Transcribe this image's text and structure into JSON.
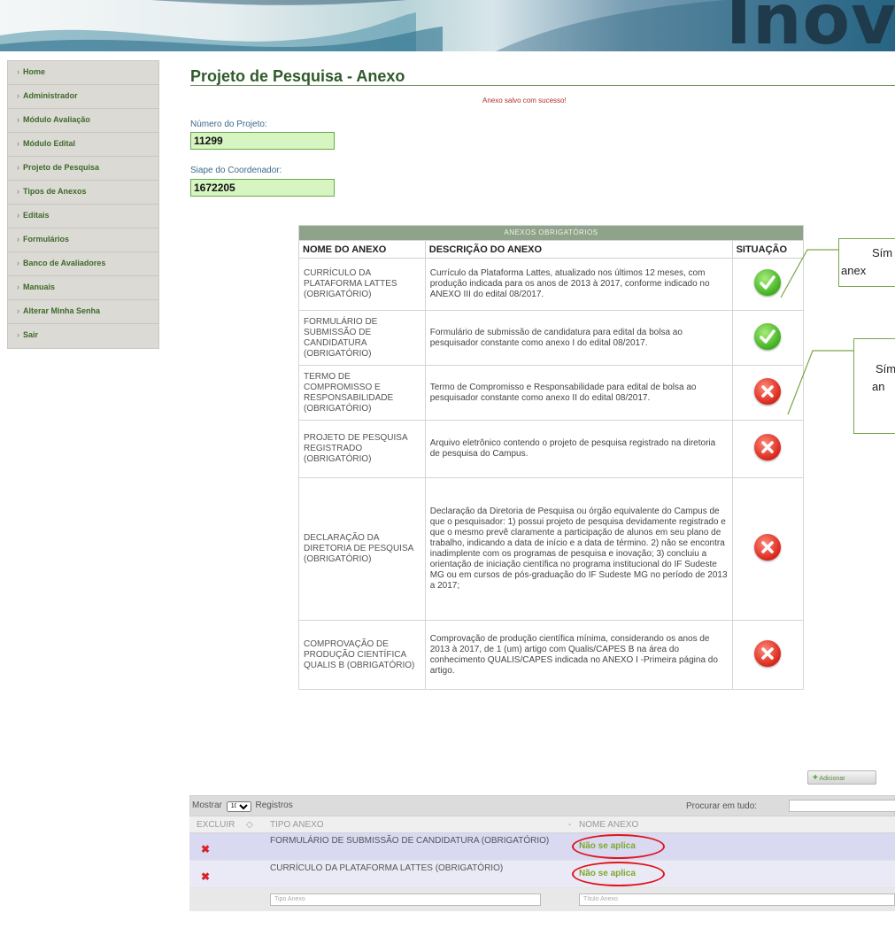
{
  "banner": {
    "title": "Inovare"
  },
  "sidebar": {
    "bullet": "›",
    "items": [
      {
        "label": "Home"
      },
      {
        "label": "Administrador"
      },
      {
        "label": "Módulo Avaliação"
      },
      {
        "label": "Módulo Edital"
      },
      {
        "label": "Projeto de Pesquisa"
      },
      {
        "label": "Tipos de Anexos"
      },
      {
        "label": "Editais"
      },
      {
        "label": "Formulários"
      },
      {
        "label": "Banco de Avaliadores"
      },
      {
        "label": "Manuais"
      },
      {
        "label": "Alterar Minha Senha"
      },
      {
        "label": "Sair"
      }
    ]
  },
  "page": {
    "title": "Projeto de Pesquisa - Anexo",
    "success_message": "Anexo salvo com sucesso!"
  },
  "form": {
    "project_number_label": "Número do Projeto:",
    "project_number_value": "11299",
    "siape_label": "Siape do Coordenador:",
    "siape_value": "1672205"
  },
  "required_table": {
    "caption": "ANEXOS OBRIGATÓRIOS",
    "headers": [
      "NOME DO ANEXO",
      "DESCRIÇÃO DO ANEXO",
      "SITUAÇÃO"
    ],
    "rows": [
      {
        "name": "CURRÍCULO DA PLATAFORMA LATTES (OBRIGATÓRIO)",
        "description": "Currículo da Plataforma Lattes, atualizado nos últimos 12 meses, com produção indicada para os anos de 2013 à 2017, conforme indicado no ANEXO III do edital 08/2017.",
        "status": "ok"
      },
      {
        "name": "FORMULÁRIO DE SUBMISSÃO DE CANDIDATURA (OBRIGATÓRIO)",
        "description": "Formulário de submissão de candidatura para edital da bolsa ao pesquisador constante como anexo I do edital 08/2017.",
        "status": "ok"
      },
      {
        "name": "TERMO DE COMPROMISSO E RESPONSABILIDADE (OBRIGATÓRIO)",
        "description": "Termo de Compromisso e Responsabilidade para edital de bolsa ao pesquisador constante como anexo II do edital 08/2017.",
        "status": "missing"
      },
      {
        "name": "PROJETO DE PESQUISA REGISTRADO (OBRIGATÓRIO)",
        "description": "Arquivo eletrônico contendo o projeto de pesquisa registrado na diretoria de pesquisa do Campus.",
        "status": "missing"
      },
      {
        "name": "DECLARAÇÃO DA DIRETORIA DE PESQUISA (OBRIGATÓRIO)",
        "description": "Declaração da Diretoria de Pesquisa ou órgão equivalente do Campus de que o pesquisador: 1) possui projeto de pesquisa devidamente registrado e que o mesmo prevê claramente a participação de alunos em seu plano de trabalho, indicando a data de início e a data de término. 2) não se encontra inadimplente com os programas de pesquisa e inovação; 3) concluiu a orientação de iniciação científica no programa institucional do IF Sudeste MG ou em cursos de pós-graduação do IF Sudeste MG no período de 2013 a 2017;",
        "status": "missing"
      },
      {
        "name": "COMPROVAÇÃO DE PRODUÇÃO CIENTÍFICA QUALIS B (OBRIGATÓRIO)",
        "description": "Comprovação de produção científica mínima, considerando os anos de 2013 à 2017, de 1 (um) artigo com Qualis/CAPES B na área do conhecimento QUALIS/CAPES indicada no ANEXO I -Primeira página do artigo.",
        "status": "missing"
      }
    ]
  },
  "callouts": {
    "first_lines": [
      "Sím",
      "anex"
    ],
    "second_lines": [
      "Sím",
      "an"
    ]
  },
  "grid": {
    "add_button_label": "Adicionar",
    "show_label": "Mostrar",
    "page_size": "10",
    "records_label": "Registros",
    "search_label": "Procurar em tudo:",
    "columns": [
      "EXCLUIR",
      "TIPO ANEXO",
      "NOME ANEXO"
    ],
    "rows": [
      {
        "tipo": "FORMULÁRIO DE SUBMISSÃO DE CANDIDATURA (OBRIGATÓRIO)",
        "nome": "Não se aplica"
      },
      {
        "tipo": "CURRÍCULO DA PLATAFORMA LATTES (OBRIGATÓRIO)",
        "nome": "Não se aplica"
      }
    ],
    "filter_tipo_placeholder": "Tipo Anexo",
    "filter_nome_placeholder": "Título Anexo"
  },
  "colors": {
    "accent_green": "#2f5a2a",
    "ok_green": "#3fb01f",
    "error_red": "#d9261a",
    "highlight_oval": "#e0141c"
  }
}
